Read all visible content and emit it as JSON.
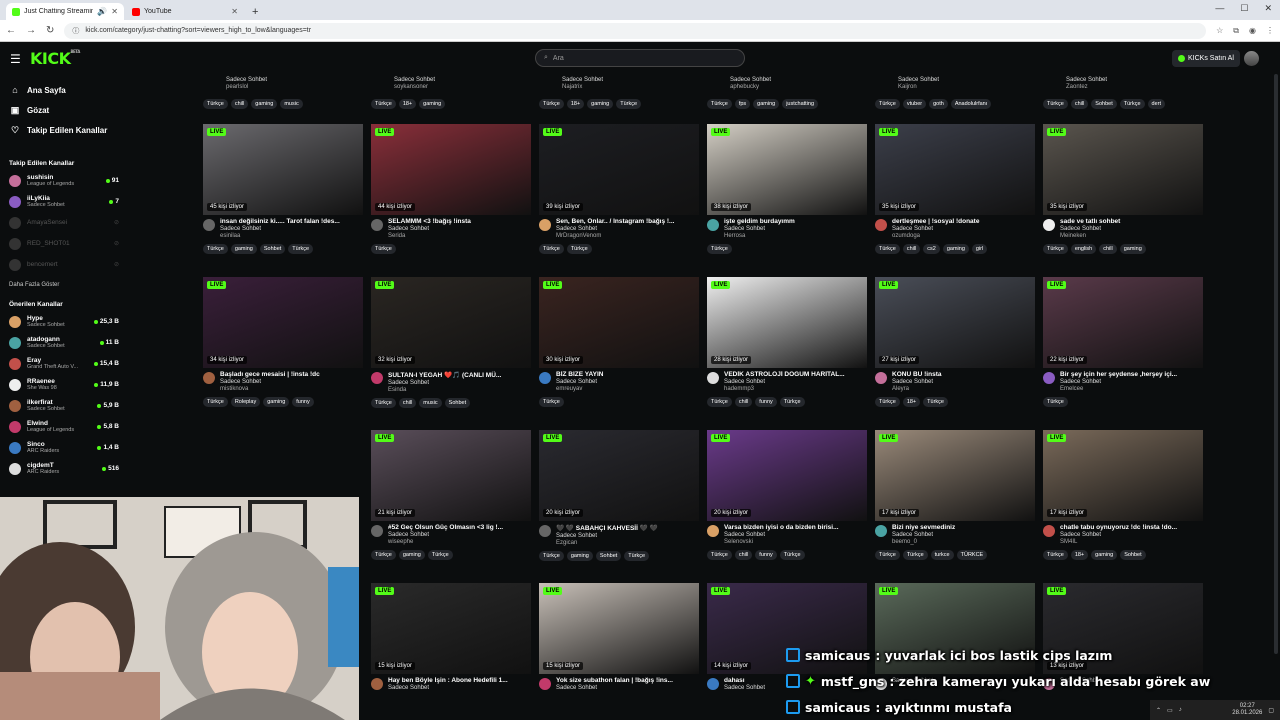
{
  "browser": {
    "tabs": [
      {
        "title": "Just Chatting Streaming - Li",
        "active": true
      },
      {
        "title": "YouTube",
        "active": false
      }
    ],
    "url": "kick.com/category/just-chatting?sort=viewers_high_to_low&languages=tr"
  },
  "header": {
    "logo": "KICK",
    "logo_badge": "BETA",
    "search_placeholder": "Ara",
    "buy_label": "KICKs Satın Al"
  },
  "sidebar": {
    "nav": [
      {
        "label": "Ana Sayfa",
        "icon": "home-icon"
      },
      {
        "label": "Gözat",
        "icon": "browse-icon"
      },
      {
        "label": "Takip Edilen Kanallar",
        "icon": "heart-icon"
      }
    ],
    "followed_title": "Takip Edilen Kanallar",
    "followed": [
      {
        "name": "sushisin",
        "sub": "League of Legends",
        "count": "91",
        "online": true
      },
      {
        "name": "iiLyKiia",
        "sub": "Sadece Sohbet",
        "count": "7",
        "online": true
      },
      {
        "name": "AmayaSensei",
        "sub": "",
        "count": "",
        "online": false
      },
      {
        "name": "RED_SHOT01",
        "sub": "",
        "count": "",
        "online": false
      },
      {
        "name": "bencemert",
        "sub": "",
        "count": "",
        "online": false
      }
    ],
    "more_label": "Daha Fazla Göster",
    "recommended_title": "Önerilen Kanallar",
    "recommended": [
      {
        "name": "Hype",
        "sub": "Sadece Sohbet",
        "count": "25,3 B"
      },
      {
        "name": "atadogann",
        "sub": "Sadece Sohbet",
        "count": "11 B"
      },
      {
        "name": "Eray",
        "sub": "Grand Theft Auto V...",
        "count": "15,4 B"
      },
      {
        "name": "RRaenee",
        "sub": "She Was 98",
        "count": "11,9 B"
      },
      {
        "name": "ilkerfirat",
        "sub": "Sadece Sohbet",
        "count": "5,9 B"
      },
      {
        "name": "Elwind",
        "sub": "League of Legends",
        "count": "5,8 B"
      },
      {
        "name": "Sinco",
        "sub": "ARC Raiders",
        "count": "1,4 B"
      },
      {
        "name": "cigdemT",
        "sub": "ARC Raiders",
        "count": "516"
      }
    ]
  },
  "top_row": [
    {
      "category": "Sadece Sohbet",
      "user": "pearlslol",
      "tags": [
        "Türkçe",
        "chill",
        "gaming",
        "music"
      ]
    },
    {
      "category": "Sadece Sohbet",
      "user": "soykansoner",
      "tags": [
        "Türkçe",
        "18+",
        "gaming"
      ]
    },
    {
      "category": "Sadece Sohbet",
      "user": "Najatrix",
      "tags": [
        "Türkçe",
        "18+",
        "gaming",
        "Türkçe"
      ]
    },
    {
      "category": "Sadece Sohbet",
      "user": "aphebucky",
      "tags": [
        "Türkçe",
        "fps",
        "gaming",
        "justchatting"
      ]
    },
    {
      "category": "Sadece Sohbet",
      "user": "Kaijron",
      "tags": [
        "Türkçe",
        "vtuber",
        "goth",
        "Anadolulrfanı"
      ]
    },
    {
      "category": "Sadece Sohbet",
      "user": "Zaontez",
      "tags": [
        "Türkçe",
        "chill",
        "Sohbet",
        "Türkçe",
        "dert"
      ]
    }
  ],
  "streams": [
    {
      "viewers": "45 kişi izliyor",
      "title": "insan değilsiniz ki..... Tarot falan !des...",
      "category": "Sadece Sohbet",
      "user": "esinilaa",
      "tags": [
        "Türkçe",
        "gaming",
        "Sohbet",
        "Türkçe"
      ]
    },
    {
      "viewers": "44 kişi izliyor",
      "title": "SELAMMM <3 !bağış !insta",
      "category": "Sadece Sohbet",
      "user": "Serida",
      "tags": [
        "Türkçe"
      ]
    },
    {
      "viewers": "39 kişi izliyor",
      "title": "Sen, Ben, Onlar.. / Instagram !bağış !...",
      "category": "Sadece Sohbet",
      "user": "MrDragonVenom",
      "tags": [
        "Türkçe",
        "Türkçe"
      ]
    },
    {
      "viewers": "38 kişi izliyor",
      "title": "işte geldim burdayımm",
      "category": "Sadece Sohbet",
      "user": "Herrosa",
      "tags": [
        "Türkçe"
      ]
    },
    {
      "viewers": "35 kişi izliyor",
      "title": "dertleşmee | !sosyal !donate",
      "category": "Sadece Sohbet",
      "user": "ozumdoga",
      "tags": [
        "Türkçe",
        "chill",
        "cs2",
        "gaming",
        "girl"
      ]
    },
    {
      "viewers": "35 kişi izliyor",
      "title": "sade ve tatlı sohbet",
      "category": "Sadece Sohbet",
      "user": "Meineken",
      "tags": [
        "Türkçe",
        "english",
        "chill",
        "gaming"
      ]
    },
    {
      "viewers": "34 kişi izliyor",
      "title": "Başladı gece mesaisi | !insta !dc",
      "category": "Sadece Sohbet",
      "user": "mistiknova",
      "tags": [
        "Türkçe",
        "Roleplay",
        "gaming",
        "funny"
      ]
    },
    {
      "viewers": "32 kişi izliyor",
      "title": "SULTAN-I YEGAH ❤️🎵 (CANLI MÜ...",
      "category": "Sadece Sohbet",
      "user": "Esinda",
      "tags": [
        "Türkçe",
        "chill",
        "music",
        "Sohbet"
      ]
    },
    {
      "viewers": "30 kişi izliyor",
      "title": "BİZ BİZE YAYIN",
      "category": "Sadece Sohbet",
      "user": "emreuyav",
      "tags": [
        "Türkçe"
      ]
    },
    {
      "viewers": "28 kişi izliyor",
      "title": "VEDİK ASTROLOJİ DOĞUM HARİTAL...",
      "category": "Sadece Sohbet",
      "user": "hademmp3",
      "tags": [
        "Türkçe",
        "chill",
        "funny",
        "Türkçe"
      ]
    },
    {
      "viewers": "27 kişi izliyor",
      "title": "KONU BU !insta",
      "category": "Sadece Sohbet",
      "user": "Aleyra",
      "tags": [
        "Türkçe",
        "18+",
        "Türkçe"
      ]
    },
    {
      "viewers": "22 kişi izliyor",
      "title": "Bir şey için her şeydense ,herşey içi...",
      "category": "Sadece Sohbet",
      "user": "Emelcee",
      "tags": [
        "Türkçe"
      ]
    },
    {
      "viewers": "",
      "title": "",
      "category": "",
      "user": "",
      "tags": []
    },
    {
      "viewers": "21 kişi izliyor",
      "title": "#52 Geç Olsun Güç Olmasın <3 lig !...",
      "category": "Sadece Sohbet",
      "user": "wiseephe",
      "tags": [
        "Türkçe",
        "gaming",
        "Türkçe"
      ]
    },
    {
      "viewers": "20 kişi izliyor",
      "title": "🖤 🖤 SABAHÇI KAHVESİİ 🖤 🖤",
      "category": "Sadece Sohbet",
      "user": "Ezgican",
      "tags": [
        "Türkçe",
        "gaming",
        "Sohbet",
        "Türkçe"
      ]
    },
    {
      "viewers": "20 kişi izliyor",
      "title": "Varsa bizden iyisi o da bizden birisi...",
      "category": "Sadece Sohbet",
      "user": "Selenovski",
      "tags": [
        "Türkçe",
        "chill",
        "funny",
        "Türkçe"
      ]
    },
    {
      "viewers": "17 kişi izliyor",
      "title": "Bizi niye sevmediniz",
      "category": "Sadece Sohbet",
      "user": "beemo_0",
      "tags": [
        "Türkçe",
        "Türkçe",
        "turkce",
        "TÜRKCE"
      ]
    },
    {
      "viewers": "17 kişi izliyor",
      "title": "chatle tabu oynuyoruz !dc !insta !do...",
      "category": "Sadece Sohbet",
      "user": "SM4IL",
      "tags": [
        "Türkçe",
        "18+",
        "gaming",
        "Sohbet"
      ]
    },
    {
      "viewers": "",
      "title": "",
      "category": "",
      "user": "",
      "tags": []
    },
    {
      "viewers": "15 kişi izliyor",
      "title": "Hay ben Böyle İşin : Abone Hedefili 1...",
      "category": "Sadece Sohbet",
      "user": "",
      "tags": []
    },
    {
      "viewers": "15 kişi izliyor",
      "title": "Yok size subathon falan | !bağış !ins...",
      "category": "Sadece Sohbet",
      "user": "",
      "tags": []
    },
    {
      "viewers": "14 kişi izliyor",
      "title": "dahası",
      "category": "Sadece Sohbet",
      "user": "",
      "tags": []
    },
    {
      "viewers": "",
      "title": "",
      "category": "Sadece Sohbet",
      "user": "",
      "tags": []
    },
    {
      "viewers": "13 kişi izliyor",
      "title": "",
      "category": "Sadece Sohbet",
      "user": "",
      "tags": []
    }
  ],
  "live_label": "LIVE",
  "chat": [
    {
      "user": "samicaus",
      "message": ": yuvarlak ici bos lastik cips lazım"
    },
    {
      "user": "mstf_gns",
      "message": ": zehra kamerayı yukarı alda hesabı görek aw"
    },
    {
      "user": "samicaus",
      "message": ": ayıktınmı mustafa"
    }
  ],
  "taskbar": {
    "time": "02:27",
    "date": "28.01.2026"
  },
  "colors": {
    "accent": "#53fc18",
    "bg": "#0b0d0e",
    "tag_bg": "#24272c"
  }
}
